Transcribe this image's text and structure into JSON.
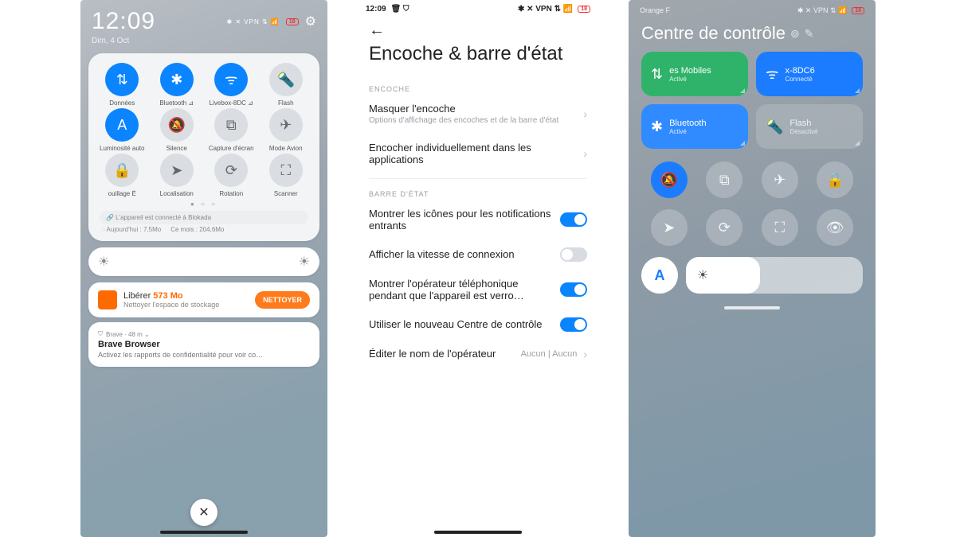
{
  "screen1": {
    "time": "12:09",
    "date": "Dim, 4 Oct",
    "status_icons": "✱ ✕ VPN ⇅ 📶",
    "battery": "18",
    "qs": [
      {
        "label": "Données",
        "on": true,
        "glyph": "⇅"
      },
      {
        "label": "Bluetooth ⊿",
        "on": true,
        "glyph": "✱"
      },
      {
        "label": "Livebox-8DC ⊿",
        "on": true,
        "glyph": "ᯤ"
      },
      {
        "label": "Flash",
        "on": false,
        "glyph": "🔦"
      },
      {
        "label": "Luminosité auto",
        "on": true,
        "glyph": "A"
      },
      {
        "label": "Silence",
        "on": false,
        "glyph": "🔕"
      },
      {
        "label": "Capture d'écran",
        "on": false,
        "glyph": "⧉"
      },
      {
        "label": "Mode Avion",
        "on": false,
        "glyph": "✈"
      },
      {
        "label": "ouillage   É",
        "on": false,
        "glyph": "🔒"
      },
      {
        "label": "Localisation",
        "on": false,
        "glyph": "➤"
      },
      {
        "label": "Rotation",
        "on": false,
        "glyph": "⟳"
      },
      {
        "label": "Scanner",
        "on": false,
        "glyph": "⛶"
      }
    ],
    "dots": "● ○ ○",
    "blokada": "🔗  L'appareil est connecté à Blokada",
    "today": "Aujourd'hui : 7,5Mo",
    "month": "Ce mois : 204,6Mo",
    "clean_title_a": "Libérer ",
    "clean_title_b": "573 Mo",
    "clean_sub": "Nettoyer l'espace de stockage",
    "clean_btn": "NETTOYER",
    "brave_src": "Brave · 48 m ⌄",
    "brave_title": "Brave Browser",
    "brave_sub": "Activez les rapports de confidentialité pour voir co…"
  },
  "screen2": {
    "time": "12:09",
    "status_left_icons": "🗑 ⛉",
    "status_right": "✱ ✕ VPN ⇅ 📶",
    "battery": "18",
    "title": "Encoche & barre d'état",
    "sect1": "ENCOCHE",
    "r1_t": "Masquer l'encoche",
    "r1_s": "Options d'affichage des encoches et de la barre d'état",
    "r2_t": "Encocher individuellement dans les applications",
    "sect2": "BARRE D'ÉTAT",
    "toggles": [
      {
        "t": "Montrer les icônes pour les notifications entrants",
        "on": true
      },
      {
        "t": "Afficher la vitesse de connexion",
        "on": false
      },
      {
        "t": "Montrer l'opérateur téléphonique pendant que l'appareil est verro…",
        "on": true
      },
      {
        "t": "Utiliser le nouveau Centre de contrôle",
        "on": true
      }
    ],
    "r_last_t": "Éditer le nom de l'opérateur",
    "r_last_v": "Aucun | Aucun"
  },
  "screen3": {
    "carrier": "Orange F",
    "status_right": "✱ ✕ VPN ⇅ 📶",
    "battery": "18",
    "title": "Centre de contrôle",
    "tiles": [
      {
        "glyph": "⇅",
        "t": "es Mobiles",
        "s": "Activé",
        "cls": "green"
      },
      {
        "glyph": "ᯤ",
        "t": "x-8DC6",
        "s": "Connecté",
        "cls": "blue"
      },
      {
        "glyph": "✱",
        "t": "Bluetooth",
        "s": "Activé",
        "cls": "blue2"
      },
      {
        "glyph": "🔦",
        "t": "Flash",
        "s": "Désactivé",
        "cls": "grey"
      }
    ],
    "circles": [
      {
        "glyph": "🔕",
        "on": true
      },
      {
        "glyph": "⧉",
        "on": false
      },
      {
        "glyph": "✈",
        "on": false
      },
      {
        "glyph": "🔒",
        "on": false
      },
      {
        "glyph": "➤",
        "on": false
      },
      {
        "glyph": "⟳",
        "on": false
      },
      {
        "glyph": "⛶",
        "on": false
      },
      {
        "glyph": "👁",
        "on": false
      }
    ],
    "autoA": "A"
  }
}
